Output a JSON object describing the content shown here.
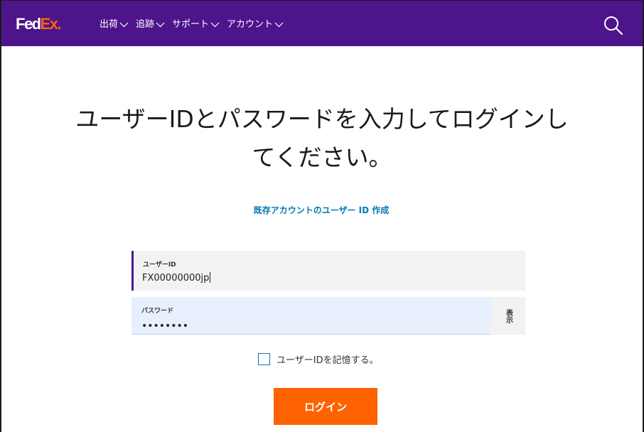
{
  "header": {
    "logo_fed": "Fed",
    "logo_ex": "Ex",
    "logo_dot": ".",
    "nav": [
      {
        "label": "出荷"
      },
      {
        "label": "追跡"
      },
      {
        "label": "サポート"
      },
      {
        "label": "アカウント"
      }
    ],
    "search_icon": "search-icon"
  },
  "main": {
    "heading_line1": "ユーザーIDとパスワードを入力してログインし",
    "heading_line2": "てください。",
    "create_link": "既存アカウントのユーザー ID 作成",
    "user_field": {
      "label": "ユーザーID",
      "value": "FX00000000jp"
    },
    "password_field": {
      "label": "パスワード",
      "value": "••••••••",
      "show_label": "表示"
    },
    "remember_label": "ユーザーIDを記憶する。",
    "login_label": "ログイン"
  },
  "colors": {
    "brand_purple": "#4d148c",
    "brand_orange": "#ff6200",
    "link_blue": "#007ab7"
  }
}
